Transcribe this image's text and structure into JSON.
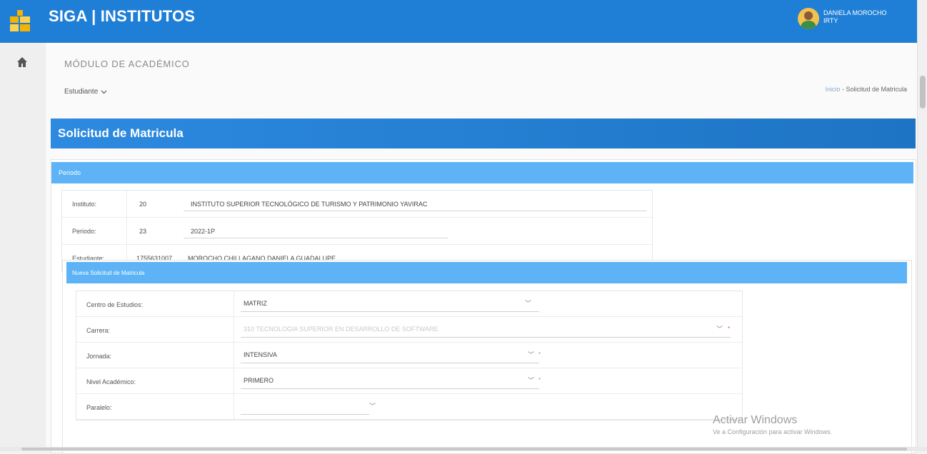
{
  "header": {
    "app_title": "SIGA | INSTITUTOS",
    "user_name": "DANIELA MOROCHO",
    "user_sub": "IRTY"
  },
  "page": {
    "module_title": "MÓDULO DE ACADÉMICO",
    "student_menu": "Estudiante",
    "breadcrumb_home": "Inicio",
    "breadcrumb_sep": " - ",
    "breadcrumb_current": "Solicitud de Matricula",
    "banner_title": "Solicitud de Matricula"
  },
  "periodo": {
    "section_title": "Periodo",
    "rows": [
      {
        "label": "Instituto:",
        "code": "20",
        "value": "INSTITUTO SUPERIOR TECNOLÓGICO DE TURISMO Y PATRIMONIO YAVIRAC"
      },
      {
        "label": "Periodo:",
        "code": "23",
        "value": "2022-1P"
      },
      {
        "label": "Estudiante:",
        "code": "1755631007",
        "value": "MOROCHO CHILLAGANO DANIELA GUADALUPE"
      }
    ]
  },
  "solicitud": {
    "section_title": "Nueva Solicitud de Matricula",
    "fields": [
      {
        "label": "Centro de Estudios:",
        "value": "MATRIZ"
      },
      {
        "label": "Carrera:",
        "value": "310 TECNOLOGIA SUPERIOR EN DESARROLLO DE SOFTWARE",
        "required": "*"
      },
      {
        "label": "Jornada:",
        "value": "INTENSIVA",
        "required": "*"
      },
      {
        "label": "Nivel Académico:",
        "value": "PRIMERO",
        "required": "*"
      },
      {
        "label": "Paralelo:",
        "value": ""
      }
    ]
  },
  "watermark": {
    "line1": "Activar Windows",
    "line2": "Ve a Configuración para activar Windows."
  },
  "colors": {
    "header": "#1f7fd6",
    "banner": "#2c8ae0",
    "section_bar": "#5db3f5"
  },
  "icons": [
    "logo-icon",
    "home-icon",
    "user-avatar",
    "chevron-down-icon"
  ]
}
